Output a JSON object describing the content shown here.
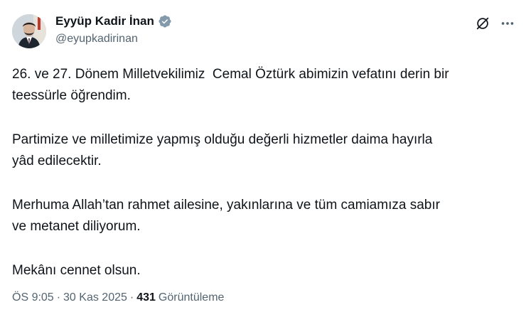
{
  "author": {
    "display_name": "Eyyüp Kadir İnan",
    "handle": "@eyupkadirinan",
    "verified": true,
    "verified_color": "#829aab"
  },
  "icons": {
    "avatar": "avatar",
    "verified": "verified-badge-icon",
    "grok": "grok-icon",
    "more": "more-options-icon"
  },
  "tweet": {
    "paragraphs": [
      "26. ve 27. Dönem Milletvekilimiz  Cemal Öztürk abimizin vefatını derin bir\nteessürle öğrendim.",
      "Partimize ve milletimize yapmış olduğu değerli hizmetler daima hayırla\nyâd edilecektir.",
      "Merhuma Allah’tan rahmet ailesine, yakınlarına ve tüm camiamıza sabır\nve metanet diliyorum.",
      "Mekânı cennet olsun."
    ]
  },
  "meta": {
    "time": "ÖS 9:05",
    "separator": "·",
    "date": "30 Kas 2025",
    "views_count": "431",
    "views_label": "Görüntüleme"
  },
  "colors": {
    "text": "#0f1419",
    "secondary_text": "#536471",
    "background": "#ffffff"
  }
}
